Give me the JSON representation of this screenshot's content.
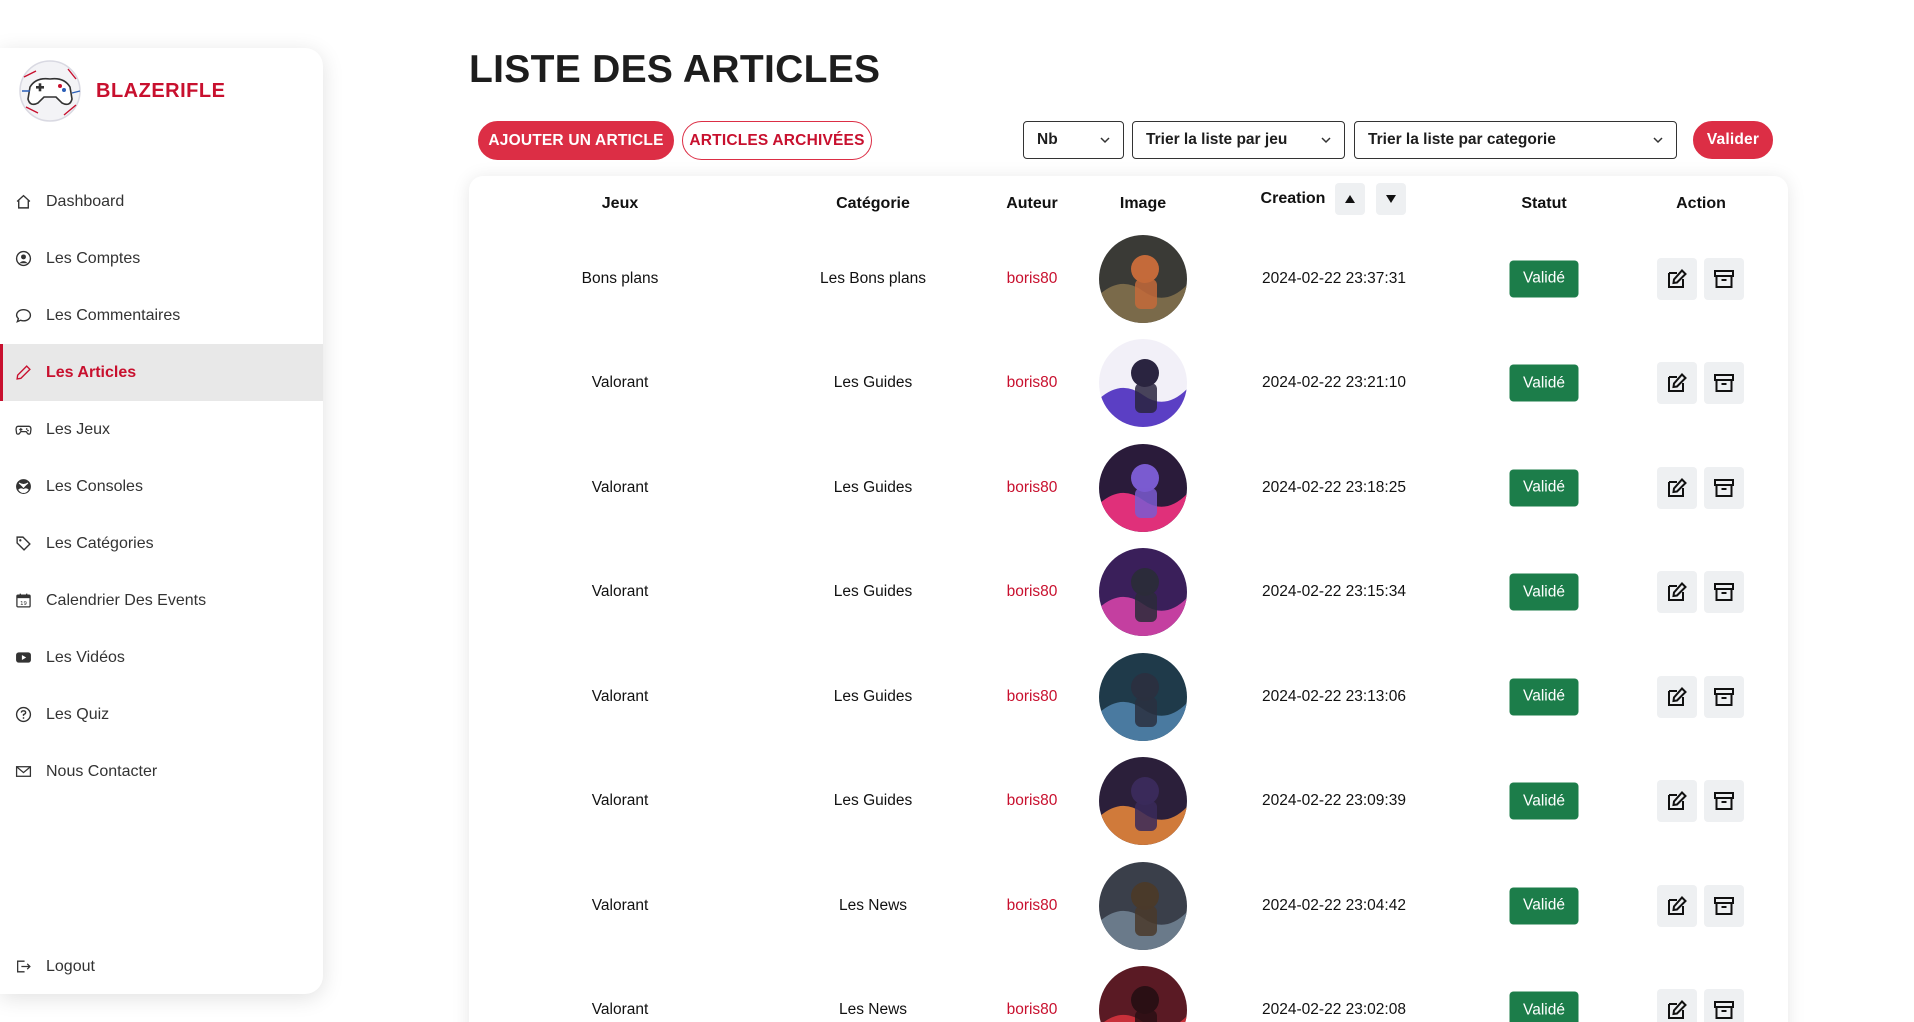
{
  "brand": {
    "name": "BLAZERIFLE"
  },
  "sidebar": {
    "items": [
      {
        "label": "Dashboard",
        "icon": "home-icon"
      },
      {
        "label": "Les Comptes",
        "icon": "user-circle-icon"
      },
      {
        "label": "Les Commentaires",
        "icon": "comment-icon"
      },
      {
        "label": "Les Articles",
        "icon": "pencil-icon",
        "active": true
      },
      {
        "label": "Les Jeux",
        "icon": "gamepad-icon"
      },
      {
        "label": "Les Consoles",
        "icon": "xbox-icon"
      },
      {
        "label": "Les Catégories",
        "icon": "tag-icon"
      },
      {
        "label": "Calendrier Des Events",
        "icon": "calendar-icon"
      },
      {
        "label": "Les Vidéos",
        "icon": "youtube-icon"
      },
      {
        "label": "Les Quiz",
        "icon": "question-circle-icon"
      },
      {
        "label": "Nous Contacter",
        "icon": "envelope-icon"
      }
    ],
    "logout": {
      "label": "Logout",
      "icon": "logout-icon"
    }
  },
  "page": {
    "title": "LISTE DES ARTICLES"
  },
  "toolbar": {
    "add_label": "AJOUTER UN ARTICLE",
    "archived_label": "ARTICLES ARCHIVÉES",
    "nb_select": "Nb",
    "game_select": "Trier la liste par jeu",
    "category_select": "Trier la liste par categorie",
    "validate_label": "Valider"
  },
  "table": {
    "headers": {
      "game": "Jeux",
      "category": "Catégorie",
      "author": "Auteur",
      "image": "Image",
      "created": "Creation",
      "status": "Statut",
      "action": "Action"
    },
    "rows": [
      {
        "game": "Bons plans",
        "category": "Les Bons plans",
        "author": "boris80",
        "created": "2024-02-22 23:37:31",
        "status": "Validé"
      },
      {
        "game": "Valorant",
        "category": "Les Guides",
        "author": "boris80",
        "created": "2024-02-22 23:21:10",
        "status": "Validé"
      },
      {
        "game": "Valorant",
        "category": "Les Guides",
        "author": "boris80",
        "created": "2024-02-22 23:18:25",
        "status": "Validé"
      },
      {
        "game": "Valorant",
        "category": "Les Guides",
        "author": "boris80",
        "created": "2024-02-22 23:15:34",
        "status": "Validé"
      },
      {
        "game": "Valorant",
        "category": "Les Guides",
        "author": "boris80",
        "created": "2024-02-22 23:13:06",
        "status": "Validé"
      },
      {
        "game": "Valorant",
        "category": "Les Guides",
        "author": "boris80",
        "created": "2024-02-22 23:09:39",
        "status": "Validé"
      },
      {
        "game": "Valorant",
        "category": "Les News",
        "author": "boris80",
        "created": "2024-02-22 23:04:42",
        "status": "Validé"
      },
      {
        "game": "Valorant",
        "category": "Les News",
        "author": "boris80",
        "created": "2024-02-22 23:02:08",
        "status": "Validé"
      }
    ]
  },
  "colors": {
    "accent": "#dc2e45",
    "brand": "#c8102e",
    "status_valid": "#1c7d4a"
  }
}
